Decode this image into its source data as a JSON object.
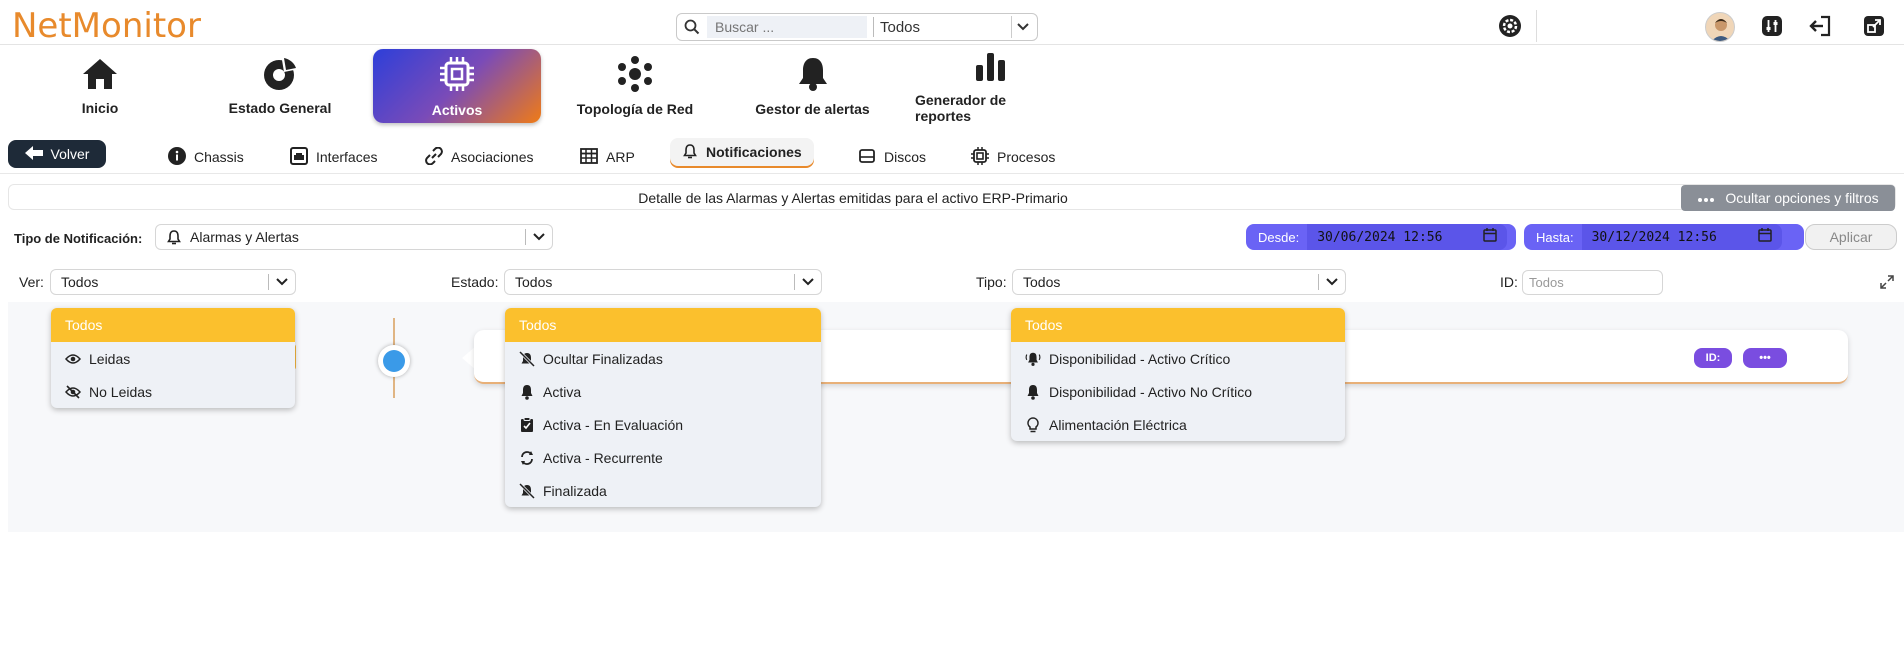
{
  "app": {
    "logo": "NetMonitor"
  },
  "search": {
    "placeholder": "Buscar ...",
    "scope": "Todos"
  },
  "mainnav": [
    {
      "label": "Inicio"
    },
    {
      "label": "Estado General"
    },
    {
      "label": "Activos"
    },
    {
      "label": "Topología de Red"
    },
    {
      "label": "Gestor de alertas"
    },
    {
      "label": "Generador de reportes"
    }
  ],
  "subnav": {
    "back": "Volver",
    "tabs": [
      {
        "label": "Chassis"
      },
      {
        "label": "Interfaces"
      },
      {
        "label": "Asociaciones"
      },
      {
        "label": "ARP"
      },
      {
        "label": "Notificaciones"
      },
      {
        "label": "Discos"
      },
      {
        "label": "Procesos"
      }
    ]
  },
  "detail": {
    "title": "Detalle de las Alarmas y Alertas emitidas para el activo ERP-Primario",
    "hide_options": "Ocultar opciones y filtros"
  },
  "filters": {
    "tipo_notif_label": "Tipo de Notificación:",
    "tipo_notif_value": "Alarmas y Alertas",
    "desde_label": "Desde:",
    "desde_value": "30/06/2024 12:56",
    "hasta_label": "Hasta:",
    "hasta_value": "30/12/2024 12:56",
    "apply": "Aplicar",
    "ver_label": "Ver:",
    "ver_value": "Todos",
    "estado_label": "Estado:",
    "estado_value": "Todos",
    "tipo_label": "Tipo:",
    "tipo_value": "Todos",
    "id_label": "ID:",
    "id_placeholder": "Todos"
  },
  "dropdowns": {
    "ver": [
      "Todos",
      "Leidas",
      "No Leidas"
    ],
    "estado": [
      "Todos",
      "Ocultar Finalizadas",
      "Activa",
      "Activa - En Evaluación",
      "Activa - Recurrente",
      "Finalizada"
    ],
    "tipo": [
      "Todos",
      "Disponibilidad - Activo Crítico",
      "Disponibilidad - Activo No Crítico",
      "Alimentación Eléctrica"
    ]
  },
  "card": {
    "id_pill": "ID:",
    "more_pill": "•••"
  },
  "colors": {
    "accent": "#e88a2c",
    "selected": "#fbc02d",
    "pill": "#7a4de0",
    "date": "#6a63f5"
  }
}
